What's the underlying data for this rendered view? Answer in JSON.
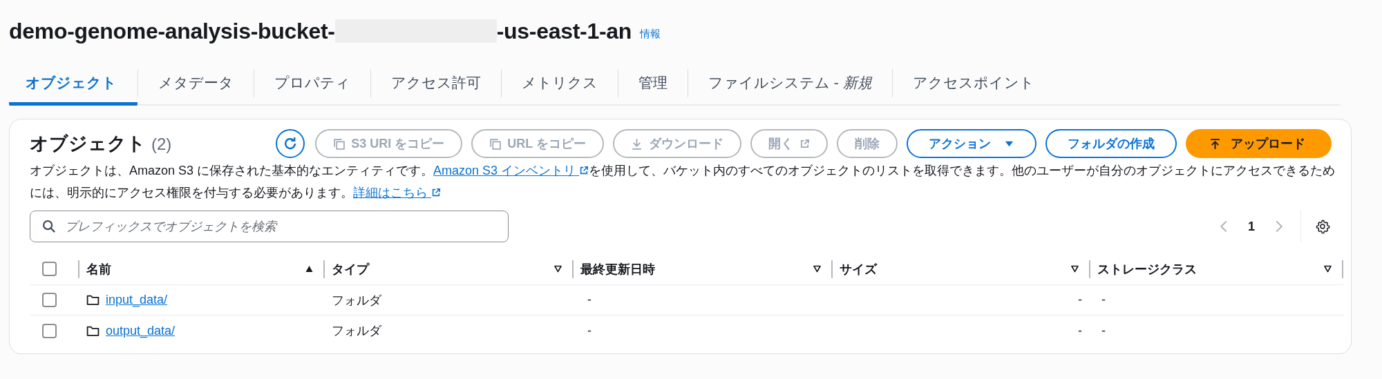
{
  "header": {
    "title_start": "demo-genome-analysis-bucket-",
    "title_redacted": true,
    "title_end": "-us-east-1-an",
    "info_link": "情報"
  },
  "tabs": [
    {
      "label": "オブジェクト",
      "selected": true
    },
    {
      "label": "メタデータ",
      "selected": false
    },
    {
      "label": "プロパティ",
      "selected": false
    },
    {
      "label": "アクセス許可",
      "selected": false
    },
    {
      "label": "メトリクス",
      "selected": false
    },
    {
      "label": "管理",
      "selected": false
    },
    {
      "label": "ファイルシステム - *新規*",
      "selected": false
    },
    {
      "label": "アクセスポイント",
      "selected": false
    }
  ],
  "panel": {
    "title": "オブジェクト",
    "count": "(2)",
    "buttons": [
      {
        "kind": "refresh",
        "disabled": false
      },
      {
        "kind": "copy",
        "label": "S3 URI をコピー",
        "disabled": true
      },
      {
        "kind": "copy",
        "label": "URL をコピー",
        "disabled": true
      },
      {
        "kind": "download",
        "label": "ダウンロード",
        "disabled": true
      },
      {
        "kind": "open",
        "label": "開く",
        "disabled": true
      },
      {
        "kind": "plain",
        "label": "削除",
        "disabled": true
      },
      {
        "kind": "dropdown",
        "label": "アクション",
        "disabled": false
      },
      {
        "kind": "plain",
        "label": "フォルダの作成",
        "disabled": false
      },
      {
        "kind": "upload",
        "label": "アップロード",
        "disabled": false
      }
    ],
    "description": [
      {
        "kind": "text",
        "text": "オブジェクトは、Amazon S3 に保存された基本的なエンティティです。"
      },
      {
        "kind": "link",
        "text": "Amazon S3 インベントリ"
      },
      {
        "kind": "text",
        "text": "を使用して、バケット内のすべてのオブジェクトのリストを取得できます。他のユーザーが自分のオブジェクトにアクセスできるためには、明示的にアクセス権限を付与する必要があります。"
      },
      {
        "kind": "link",
        "text": "詳細はこちら"
      }
    ],
    "search": {
      "placeholder": "プレフィックスでオブジェクトを検索"
    },
    "pagination": {
      "page": "1",
      "prev_disabled": true,
      "next_disabled": true
    }
  },
  "table": {
    "select_all_checked": false,
    "columns": [
      {
        "label": "名前",
        "sorted_ascending": true
      },
      {
        "label": "タイプ",
        "sorted_ascending": false
      },
      {
        "label": "最終更新日時",
        "sorted_ascending": false
      },
      {
        "label": "サイズ",
        "sorted_ascending": false
      },
      {
        "label": "ストレージクラス",
        "sorted_ascending": false
      }
    ],
    "rows": [
      {
        "checked": false,
        "name": "input_data/",
        "type": "フォルダ",
        "last_modified": "-",
        "size": "-",
        "storage_class": "-"
      },
      {
        "checked": false,
        "name": "output_data/",
        "type": "フォルダ",
        "last_modified": "-",
        "size": "-",
        "storage_class": "-"
      }
    ]
  }
}
